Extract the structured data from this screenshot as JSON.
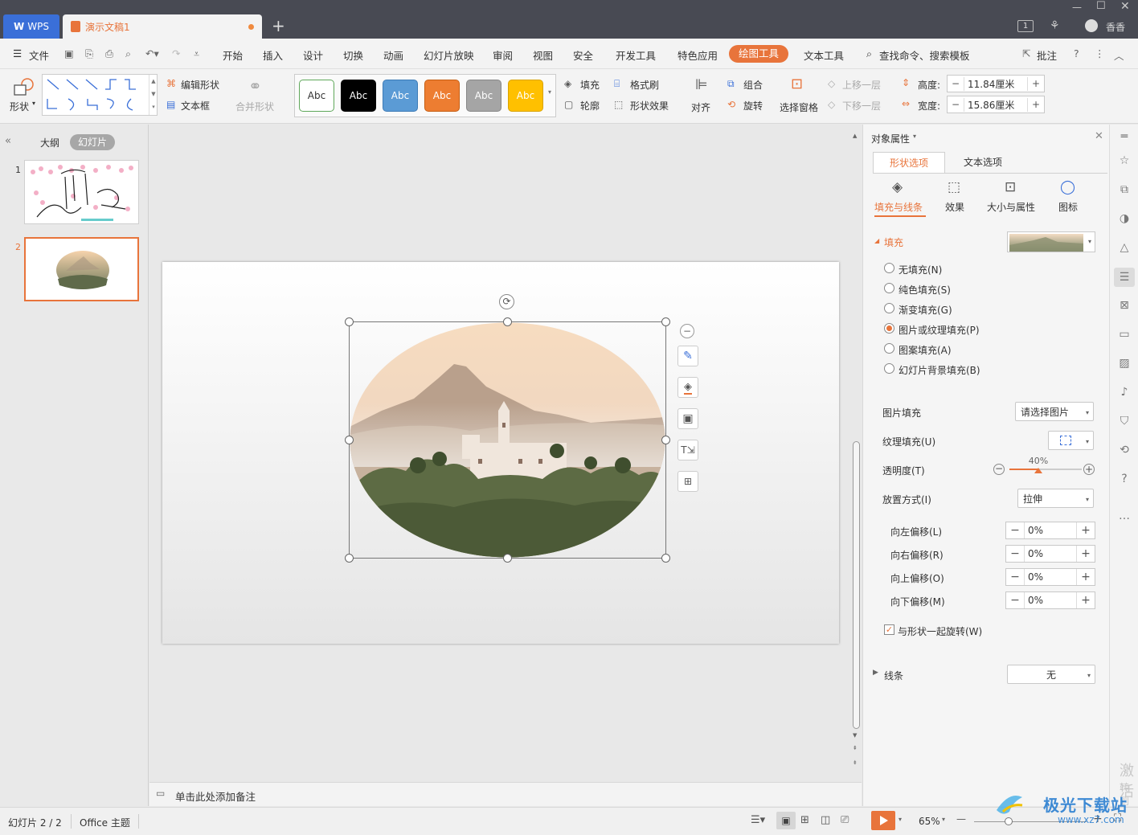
{
  "titlebar": {
    "wps_label": "WPS",
    "doc_tab": "演示文稿1",
    "user": "香香",
    "badge": "1"
  },
  "menu": {
    "file": "文件",
    "items": [
      "开始",
      "插入",
      "设计",
      "切换",
      "动画",
      "幻灯片放映",
      "审阅",
      "视图",
      "安全",
      "开发工具",
      "特色应用",
      "绘图工具",
      "文本工具"
    ],
    "search": "查找命令、搜索模板",
    "comment": "批注"
  },
  "ribbon": {
    "shape": "形状",
    "edit_shape": "编辑形状",
    "text_box": "文本框",
    "merge_shape": "合并形状",
    "style_abc": [
      "Abc",
      "Abc",
      "Abc",
      "Abc",
      "Abc",
      "Abc"
    ],
    "fill": "填充",
    "format_painter": "格式刷",
    "outline": "轮廓",
    "shape_effect": "形状效果",
    "align": "对齐",
    "group": "组合",
    "rotate": "旋转",
    "select_pane": "选择窗格",
    "bring_forward": "上移一层",
    "send_backward": "下移一层",
    "height_label": "高度:",
    "height_value": "11.84厘米",
    "width_label": "宽度:",
    "width_value": "15.86厘米"
  },
  "left_panel": {
    "outline_tab": "大纲",
    "slides_tab": "幻灯片",
    "slide_numbers": [
      "1",
      "2"
    ]
  },
  "notes": {
    "placeholder": "单击此处添加备注"
  },
  "right_panel": {
    "title": "对象属性",
    "tab_shape": "形状选项",
    "tab_text": "文本选项",
    "sub_fill_line": "填充与线条",
    "sub_effect": "效果",
    "sub_size": "大小与属性",
    "sub_icon": "图标",
    "fill_section": "填充",
    "fill_options": [
      "无填充(N)",
      "纯色填充(S)",
      "渐变填充(G)",
      "图片或纹理填充(P)",
      "图案填充(A)",
      "幻灯片背景填充(B)"
    ],
    "fill_selected_index": 3,
    "picture_fill_label": "图片填充",
    "picture_fill_value": "请选择图片",
    "texture_fill_label": "纹理填充(U)",
    "transparency_label": "透明度(T)",
    "transparency_value": "40%",
    "transparency_fraction": 0.4,
    "placement_label": "放置方式(I)",
    "placement_value": "拉伸",
    "offsets": [
      {
        "label": "向左偏移(L)",
        "value": "0%"
      },
      {
        "label": "向右偏移(R)",
        "value": "0%"
      },
      {
        "label": "向上偏移(O)",
        "value": "0%"
      },
      {
        "label": "向下偏移(M)",
        "value": "0%"
      }
    ],
    "rotate_with_shape": "与形状一起旋转(W)",
    "line_section": "线条",
    "line_value": "无"
  },
  "status": {
    "slide_info": "幻灯片 2 / 2",
    "theme": "Office 主题",
    "zoom": "65%"
  },
  "watermark": {
    "text": "极光下载站",
    "url": "www.xz7.com",
    "activate": "激活",
    "goto": "转到"
  },
  "colors": {
    "accent": "#e8743b",
    "wps_blue": "#3a6fd8",
    "titlebar": "#484a53"
  }
}
